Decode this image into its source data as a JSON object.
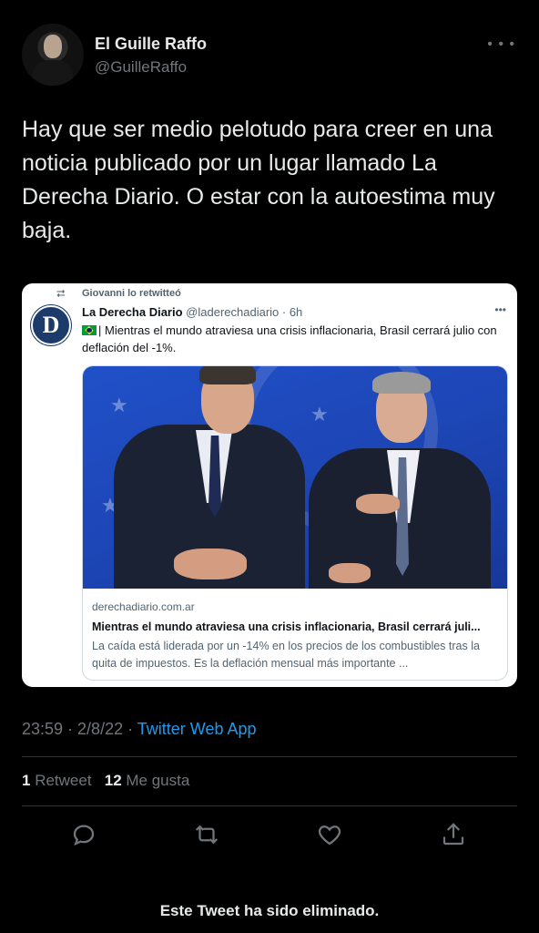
{
  "author": {
    "name": "El Guille Raffo",
    "handle": "@GuilleRaffo"
  },
  "tweet": {
    "text": "Hay que ser medio pelotudo para creer en una noticia publicado por un lugar llamado La Derecha Diario. O estar con la autoestima muy baja."
  },
  "quoted": {
    "retweeted_by": "Giovanni lo retwitteó",
    "avatar_letter": "D",
    "name": "La Derecha Diario",
    "handle": "@laderechadiario · 6h",
    "text": "| Mientras el mundo atraviesa una crisis inflacionaria, Brasil cerrará julio con deflación del -1%.",
    "link_card": {
      "domain": "derechadiario.com.ar",
      "title": "Mientras el mundo atraviesa una crisis inflacionaria, Brasil cerrará juli...",
      "description": "La caída está liderada por un -14% en los precios de los combustibles tras la quita de impuestos. Es la deflación mensual más importante ..."
    }
  },
  "meta": {
    "time_date": "23:59 · 2/8/22 · ",
    "source": "Twitter Web App"
  },
  "stats": {
    "retweets_count": "1",
    "retweets_label": " Retweet",
    "likes_count": "12",
    "likes_label": " Me gusta"
  },
  "footer": {
    "deleted_notice": "Este Tweet ha sido eliminado."
  },
  "icons": {
    "more": "more-icon",
    "retweet": "retweet-icon",
    "reply": "reply-icon",
    "like": "heart-icon",
    "share": "share-icon"
  },
  "colors": {
    "background": "#000000",
    "link": "#1d9bf0",
    "muted": "#71767b"
  }
}
